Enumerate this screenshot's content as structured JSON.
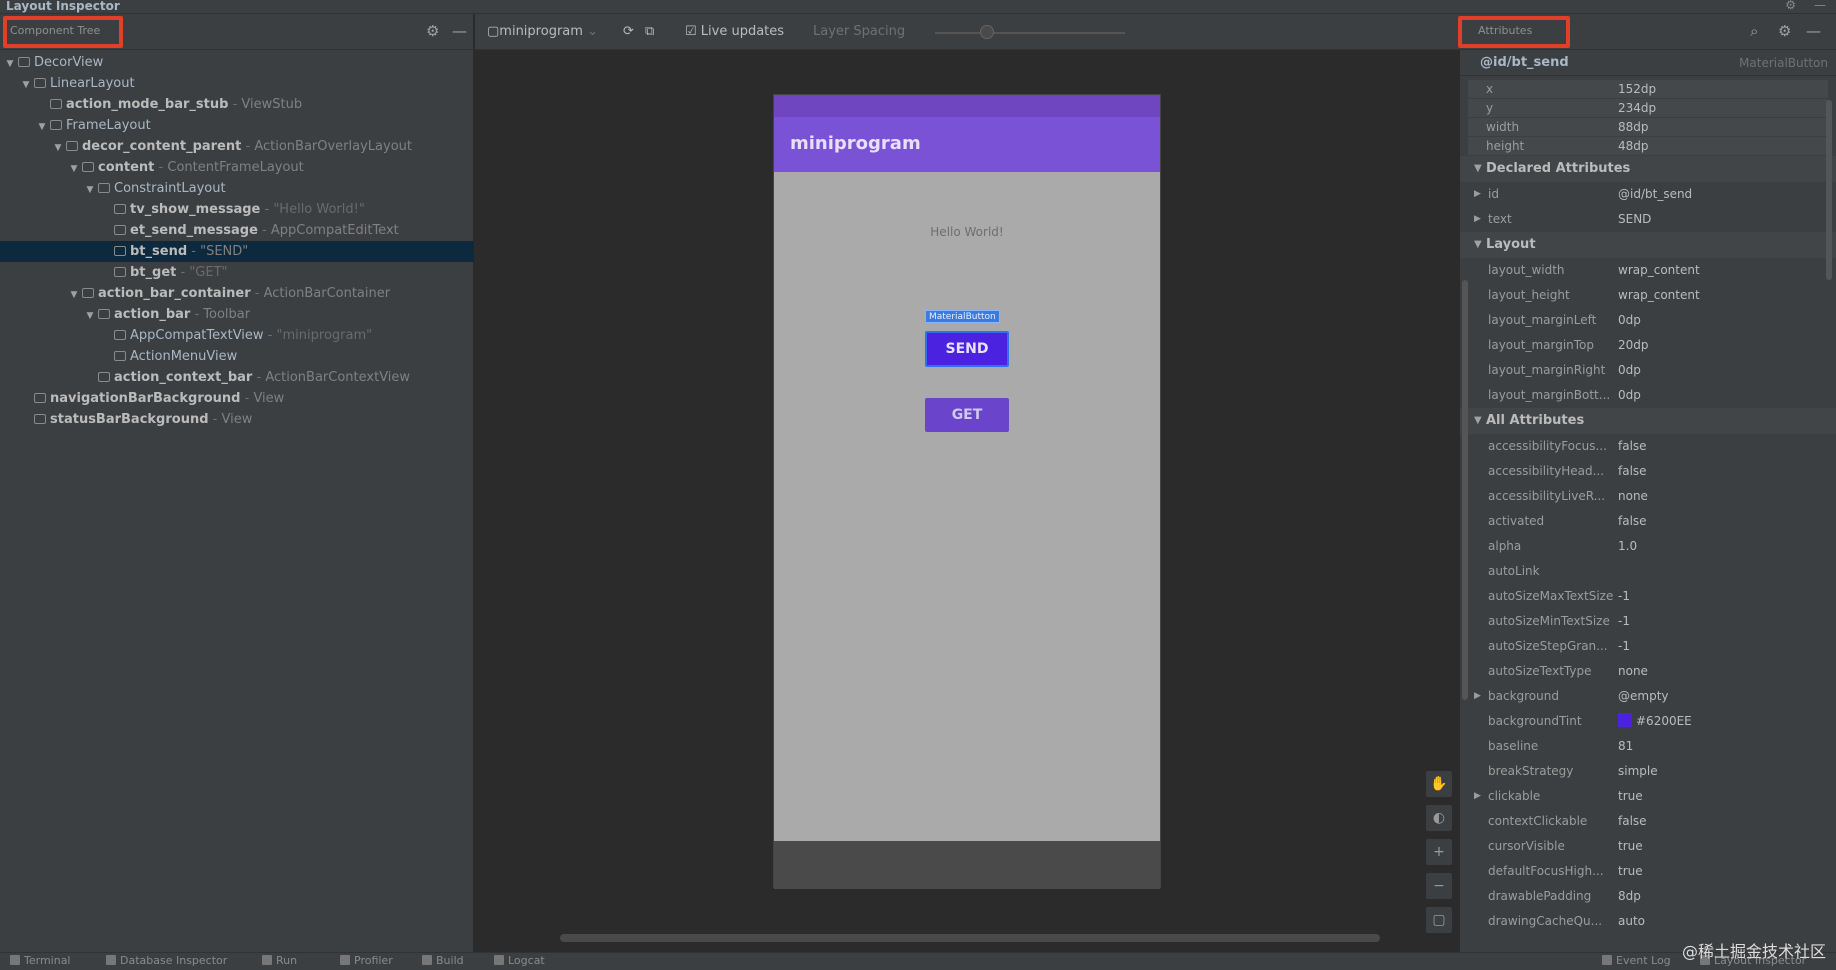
{
  "window": {
    "title": "Layout Inspector"
  },
  "left_panel": {
    "header_label": "Component Tree",
    "tree": [
      {
        "depth": 0,
        "arrow": "▼",
        "name": "DecorView",
        "bold": false,
        "type": "",
        "string": ""
      },
      {
        "depth": 1,
        "arrow": "▼",
        "name": "LinearLayout",
        "bold": false,
        "type": "",
        "string": ""
      },
      {
        "depth": 2,
        "arrow": "",
        "name": "action_mode_bar_stub",
        "bold": true,
        "type": "ViewStub",
        "string": ""
      },
      {
        "depth": 2,
        "arrow": "▼",
        "name": "FrameLayout",
        "bold": false,
        "type": "",
        "string": ""
      },
      {
        "depth": 3,
        "arrow": "▼",
        "name": "decor_content_parent",
        "bold": true,
        "type": "ActionBarOverlayLayout",
        "string": ""
      },
      {
        "depth": 4,
        "arrow": "▼",
        "name": "content",
        "bold": true,
        "type": "ContentFrameLayout",
        "string": ""
      },
      {
        "depth": 5,
        "arrow": "▼",
        "name": "ConstraintLayout",
        "bold": false,
        "type": "",
        "string": ""
      },
      {
        "depth": 6,
        "arrow": "",
        "name": "tv_show_message",
        "bold": true,
        "type": "",
        "string": "\"Hello World!\""
      },
      {
        "depth": 6,
        "arrow": "",
        "name": "et_send_message",
        "bold": true,
        "type": "AppCompatEditText",
        "string": ""
      },
      {
        "depth": 6,
        "arrow": "",
        "name": "bt_send",
        "bold": true,
        "type": "",
        "string": "\"SEND\"",
        "selected": true
      },
      {
        "depth": 6,
        "arrow": "",
        "name": "bt_get",
        "bold": true,
        "type": "",
        "string": "\"GET\""
      },
      {
        "depth": 4,
        "arrow": "▼",
        "name": "action_bar_container",
        "bold": true,
        "type": "ActionBarContainer",
        "string": ""
      },
      {
        "depth": 5,
        "arrow": "▼",
        "name": "action_bar",
        "bold": true,
        "type": "Toolbar",
        "string": ""
      },
      {
        "depth": 6,
        "arrow": "",
        "name": "AppCompatTextView",
        "bold": false,
        "type": "",
        "string": "\"miniprogram\""
      },
      {
        "depth": 6,
        "arrow": "",
        "name": "ActionMenuView",
        "bold": false,
        "type": "",
        "string": ""
      },
      {
        "depth": 5,
        "arrow": "",
        "name": "action_context_bar",
        "bold": true,
        "type": "ActionBarContextView",
        "string": ""
      },
      {
        "depth": 1,
        "arrow": "",
        "name": "navigationBarBackground",
        "bold": true,
        "type": "View",
        "string": ""
      },
      {
        "depth": 1,
        "arrow": "",
        "name": "statusBarBackground",
        "bold": true,
        "type": "View",
        "string": ""
      }
    ]
  },
  "toolbar": {
    "process": "miniprogram",
    "live_updates_label": "Live updates",
    "layer_spacing_label": "Layer Spacing"
  },
  "device": {
    "app_title": "miniprogram",
    "hello_text": "Hello World!",
    "selection_tag": "MaterialButton",
    "send_label": "SEND",
    "get_label": "GET"
  },
  "right_panel": {
    "header_label": "Attributes",
    "view_id": "@id/bt_send",
    "view_class": "MaterialButton",
    "geometry": [
      {
        "k": "x",
        "v": "152dp"
      },
      {
        "k": "y",
        "v": "234dp"
      },
      {
        "k": "width",
        "v": "88dp"
      },
      {
        "k": "height",
        "v": "48dp"
      }
    ],
    "declared_title": "Declared Attributes",
    "declared": [
      {
        "k": "id",
        "v": "@id/bt_send",
        "exp": "▶"
      },
      {
        "k": "text",
        "v": "SEND",
        "exp": "▶"
      }
    ],
    "layout_title": "Layout",
    "layout": [
      {
        "k": "layout_width",
        "v": "wrap_content"
      },
      {
        "k": "layout_height",
        "v": "wrap_content"
      },
      {
        "k": "layout_marginLeft",
        "v": "0dp"
      },
      {
        "k": "layout_marginTop",
        "v": "20dp"
      },
      {
        "k": "layout_marginRight",
        "v": "0dp"
      },
      {
        "k": "layout_marginBott...",
        "v": "0dp"
      }
    ],
    "all_title": "All Attributes",
    "all": [
      {
        "k": "accessibilityFocus...",
        "v": "false"
      },
      {
        "k": "accessibilityHead...",
        "v": "false"
      },
      {
        "k": "accessibilityLiveR...",
        "v": "none"
      },
      {
        "k": "activated",
        "v": "false"
      },
      {
        "k": "alpha",
        "v": "1.0"
      },
      {
        "k": "autoLink",
        "v": ""
      },
      {
        "k": "autoSizeMaxTextSize",
        "v": "-1"
      },
      {
        "k": "autoSizeMinTextSize",
        "v": "-1"
      },
      {
        "k": "autoSizeStepGran...",
        "v": "-1"
      },
      {
        "k": "autoSizeTextType",
        "v": "none"
      },
      {
        "k": "background",
        "v": "@empty",
        "exp": "▶"
      },
      {
        "k": "backgroundTint",
        "v": "#6200EE",
        "swatch": "#4a22e0"
      },
      {
        "k": "baseline",
        "v": "81"
      },
      {
        "k": "breakStrategy",
        "v": "simple"
      },
      {
        "k": "clickable",
        "v": "true",
        "exp": "▶"
      },
      {
        "k": "contextClickable",
        "v": "false"
      },
      {
        "k": "cursorVisible",
        "v": "true"
      },
      {
        "k": "defaultFocusHigh...",
        "v": "true"
      },
      {
        "k": "drawablePadding",
        "v": "8dp"
      },
      {
        "k": "drawingCacheQu...",
        "v": "auto"
      }
    ]
  },
  "bottom_bar": {
    "items": [
      "Terminal",
      "Database Inspector",
      "Run",
      "Profiler",
      "Build",
      "Logcat"
    ],
    "right_items": [
      "Event Log",
      "Layout Inspector"
    ]
  },
  "watermark": "@稀土掘金技术社区",
  "colors": {
    "accent_purple": "#7a52d6",
    "button_primary": "#4a22e0",
    "highlight_box": "#e0402a",
    "selection_row": "#0d293e"
  }
}
